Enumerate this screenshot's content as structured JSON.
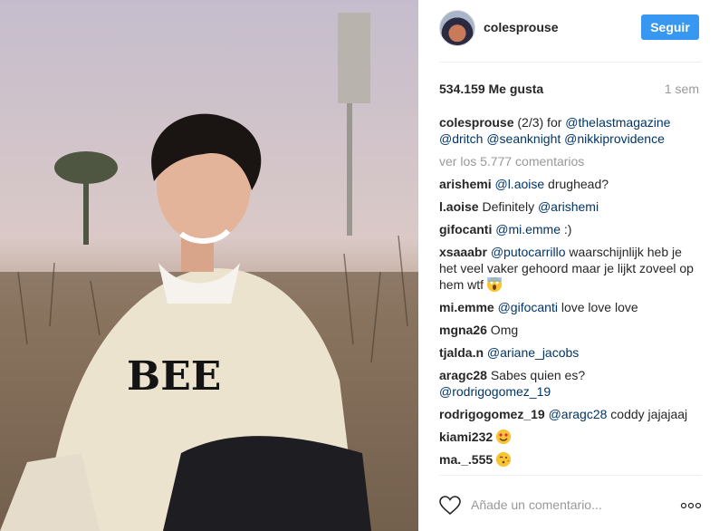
{
  "post": {
    "photo_alt": "",
    "author": "colesprouse",
    "follow_label": "Seguir",
    "likes": "534.159 Me gusta",
    "time": "1 sem",
    "caption": {
      "user": "colesprouse",
      "text": " (2/3) for ",
      "mentions": [
        "@thelastmagazine",
        "@dritch",
        "@seanknight",
        "@nikkiprovidence"
      ]
    },
    "view_all": "ver los 5.777 comentarios",
    "comments": [
      {
        "user": "arishemi",
        "mention": "@l.aoise",
        "text": " drughead?"
      },
      {
        "user": "l.aoise",
        "text": " Definitely ",
        "mention": "@arishemi"
      },
      {
        "user": "gifocanti",
        "mention": "@mi.emme",
        "text": " :)"
      },
      {
        "user": "xsaaabr",
        "mention": "@putocarrillo",
        "text": " waarschijnlijk heb je het veel vaker gehoord maar je lijkt zoveel op hem wtf ",
        "emoji": "scream-emoji"
      },
      {
        "user": "mi.emme",
        "mention": "@gifocanti",
        "text": " love love love"
      },
      {
        "user": "mgna26",
        "text": " Omg"
      },
      {
        "user": "tjalda.n",
        "mention": "@ariane_jacobs"
      },
      {
        "user": "aragc28",
        "text": " Sabes quien es? ",
        "mention": "@rodrigogomez_19"
      },
      {
        "user": "rodrigogomez_19",
        "mention": "@aragc28",
        "text": " coddy jajajaaj"
      },
      {
        "user": "kiami232",
        "emoji": "heart-eyes-emoji"
      },
      {
        "user": "ma._.555",
        "emoji": "kiss-emoji"
      }
    ],
    "add_comment_placeholder": "Añade un comentario...",
    "icons": [
      "heart-icon",
      "more-options-icon"
    ],
    "accent_color": "#3897f0",
    "mention_color": "#003569"
  }
}
